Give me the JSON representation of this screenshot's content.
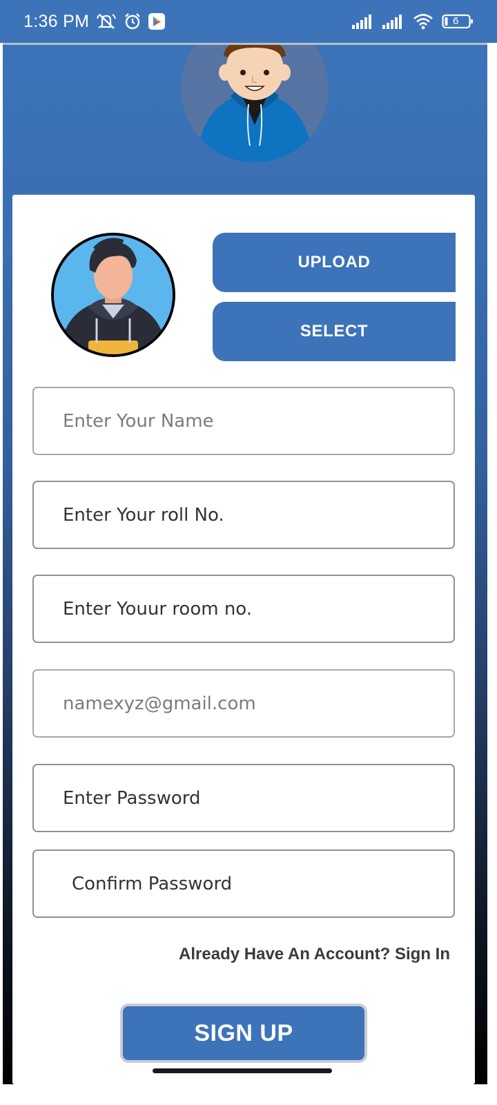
{
  "status_bar": {
    "time": "1:36 PM",
    "battery": "6"
  },
  "form": {
    "upload_label": "UPLOAD",
    "select_label": "SELECT",
    "name_placeholder": "Enter Your Name",
    "roll_value": "Enter Your roll No.",
    "room_value": "Enter Youur room no.",
    "email_placeholder": "namexyz@gmail.com",
    "password_value": "Enter Password",
    "confirm_password_value": "Confirm Password",
    "signin_link": "Already Have An Account? Sign In",
    "signup_label": "SIGN UP"
  },
  "colors": {
    "accent": "#3d73b9",
    "status_bar": "#3d73b9"
  },
  "icons": {
    "status_left": [
      "mute-icon",
      "alarm-icon",
      "play-store-icon"
    ],
    "status_right": [
      "signal-icon",
      "signal-icon",
      "wifi-icon",
      "battery-icon"
    ]
  }
}
